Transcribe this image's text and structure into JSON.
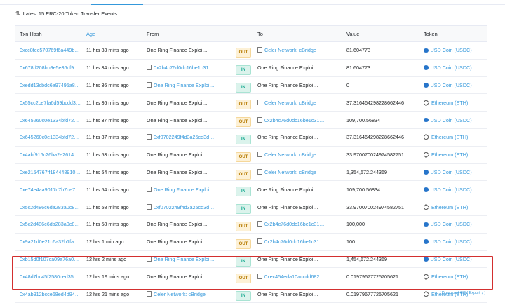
{
  "header_text": "Latest 15 ERC-20 Token Transfer Events",
  "columns": {
    "hash": "Txn Hash",
    "age": "Age",
    "from": "From",
    "to": "To",
    "value": "Value",
    "token": "Token"
  },
  "rows": [
    {
      "hash": "0xcc8fec570769f6a449b…",
      "age": "11 hrs 33 mins ago",
      "from": "One Ring Finance Exploi…",
      "from_link": false,
      "dir": "OUT",
      "to": "Celer Network: cBridge",
      "to_link": true,
      "value": "81.604773",
      "token": "USD Coin (USDC)",
      "token_icon": "usdc-icon"
    },
    {
      "hash": "0x678d208bb9e5e36cf9…",
      "age": "11 hrs 34 mins ago",
      "from": "0x2b4c76d0dc16be1c31…",
      "from_link": true,
      "dir": "IN",
      "to": "One Ring Finance Exploi…",
      "to_link": false,
      "value": "81.604773",
      "token": "USD Coin (USDC)",
      "token_icon": "usdc-icon"
    },
    {
      "hash": "0xedd13cbdc6a97495a8…",
      "age": "11 hrs 36 mins ago",
      "from": "One Ring Finance Exploi…",
      "from_link": true,
      "dir": "IN",
      "to": "One Ring Finance Exploi…",
      "to_link": false,
      "value": "0",
      "token": "USD Coin (USDC)",
      "token_icon": "usdc-icon"
    },
    {
      "hash": "0x55cc2ce7fa6d59bcdd3…",
      "age": "11 hrs 36 mins ago",
      "from": "One Ring Finance Exploi…",
      "from_link": false,
      "dir": "OUT",
      "to": "Celer Network: cBridge",
      "to_link": true,
      "value": "37.316464298228662446",
      "token": "Ethereum (ETH)",
      "token_icon": "eth-icon"
    },
    {
      "hash": "0x645260c0e1334bfd72…",
      "age": "11 hrs 37 mins ago",
      "from": "One Ring Finance Exploi…",
      "from_link": false,
      "dir": "OUT",
      "to": "0x2b4c76d0dc16be1c31…",
      "to_link": true,
      "value": "109,700.56834",
      "token": "USD Coin (USDC)",
      "token_icon": "usdc-icon"
    },
    {
      "hash": "0x645260c0e1334bfd72…",
      "age": "11 hrs 37 mins ago",
      "from": "0xf0702249f4d3a25cd3d…",
      "from_link": true,
      "dir": "IN",
      "to": "One Ring Finance Exploi…",
      "to_link": false,
      "value": "37.316464298228662446",
      "token": "Ethereum (ETH)",
      "token_icon": "eth-icon"
    },
    {
      "hash": "0x4abf916c26ba2e2614…",
      "age": "11 hrs 53 mins ago",
      "from": "One Ring Finance Exploi…",
      "from_link": false,
      "dir": "OUT",
      "to": "Celer Network: cBridge",
      "to_link": true,
      "value": "33.970070024974582751",
      "token": "Ethereum (ETH)",
      "token_icon": "eth-icon"
    },
    {
      "hash": "0xe2154767ff184448910…",
      "age": "11 hrs 54 mins ago",
      "from": "One Ring Finance Exploi…",
      "from_link": false,
      "dir": "OUT",
      "to": "Celer Network: cBridge",
      "to_link": true,
      "value": "1,354,572.244369",
      "token": "USD Coin (USDC)",
      "token_icon": "usdc-icon"
    },
    {
      "hash": "0xe74e4aa9017c7b7de7…",
      "age": "11 hrs 54 mins ago",
      "from": "One Ring Finance Exploi…",
      "from_link": true,
      "dir": "IN",
      "to": "One Ring Finance Exploi…",
      "to_link": false,
      "value": "109,700.56834",
      "token": "USD Coin (USDC)",
      "token_icon": "usdc-icon"
    },
    {
      "hash": "0x5c2d486c6da283a0c8…",
      "age": "11 hrs 58 mins ago",
      "from": "0xf0702249f4d3a25cd3d…",
      "from_link": true,
      "dir": "IN",
      "to": "One Ring Finance Exploi…",
      "to_link": false,
      "value": "33.970070024974582751",
      "token": "Ethereum (ETH)",
      "token_icon": "eth-icon"
    },
    {
      "hash": "0x5c2d486c6da283a0c8…",
      "age": "11 hrs 58 mins ago",
      "from": "One Ring Finance Exploi…",
      "from_link": false,
      "dir": "OUT",
      "to": "0x2b4c76d0dc16be1c31…",
      "to_link": true,
      "value": "100,000",
      "token": "USD Coin (USDC)",
      "token_icon": "usdc-icon"
    },
    {
      "hash": "0x9a21d0e21c6a32b1fa…",
      "age": "12 hrs 1 min ago",
      "from": "One Ring Finance Exploi…",
      "from_link": false,
      "dir": "OUT",
      "to": "0x2b4c76d0dc16be1c31…",
      "to_link": true,
      "value": "100",
      "token": "USD Coin (USDC)",
      "token_icon": "usdc-icon"
    },
    {
      "hash": "0xb15d0f107ca09a76a0…",
      "age": "12 hrs 2 mins ago",
      "from": "One Ring Finance Exploi…",
      "from_link": true,
      "dir": "IN",
      "to": "One Ring Finance Exploi…",
      "to_link": false,
      "value": "1,454,672.244369",
      "token": "USD Coin (USDC)",
      "token_icon": "usdc-icon"
    },
    {
      "hash": "0x48d7bc45f2580ced35…",
      "age": "12 hrs 19 mins ago",
      "from": "One Ring Finance Exploi…",
      "from_link": false,
      "dir": "OUT",
      "to": "0xec454eda10accdd682…",
      "to_link": true,
      "value": "0.01979677725705621",
      "token": "Ethereum (ETH)",
      "token_icon": "eth-icon"
    },
    {
      "hash": "0x4ab912bcce68ed4d94…",
      "age": "12 hrs 21 mins ago",
      "from": "Celer Network: cBridge",
      "from_link": true,
      "dir": "IN",
      "to": "One Ring Finance Exploi…",
      "to_link": false,
      "value": "0.01979677725705621",
      "token": "Ethereum (ETH)",
      "token_icon": "eth-icon"
    }
  ],
  "footer_text": "[ Download CSV Export ↓ ]"
}
